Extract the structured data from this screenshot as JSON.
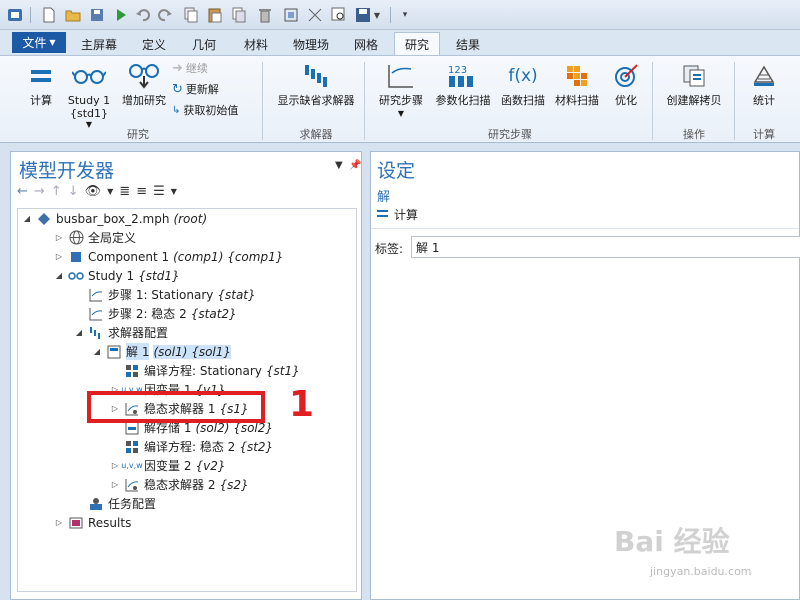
{
  "ribbon": {
    "file_label": "文件",
    "tabs": [
      "主屏幕",
      "定义",
      "几何",
      "材料",
      "物理场",
      "网格",
      "研究",
      "结果"
    ],
    "active_tab": "研究",
    "buttons": {
      "compute": "计算",
      "study1_line1": "Study 1",
      "study1_line2": "{std1}",
      "add_study": "增加研究",
      "continue": "继续",
      "update_solution": "更新解",
      "get_initial": "获取初始值",
      "show_default_solver": "显示缺省求解器",
      "study_steps": "研究步骤",
      "parametric_sweep": "参数化扫描",
      "function_sweep": "函数扫描",
      "material_sweep": "材料扫描",
      "optimization": "优化",
      "create_solution_copy": "创建解拷贝",
      "statistics": "统计"
    },
    "groups": {
      "study": "研究",
      "solver": "求解器",
      "study_steps": "研究步骤",
      "operations": "操作",
      "compute": "计算"
    }
  },
  "model_builder": {
    "title": "模型开发器",
    "tree": [
      {
        "id": "root",
        "label": "busbar_box_2.mph",
        "tag": "(root)"
      },
      {
        "id": "global",
        "label": "全局定义",
        "tag": ""
      },
      {
        "id": "comp1",
        "label": "Component 1",
        "tag": "(comp1) {comp1}"
      },
      {
        "id": "study1",
        "label": "Study 1",
        "tag": "{std1}"
      },
      {
        "id": "step1",
        "label": "步骤 1: Stationary",
        "tag": "{stat}"
      },
      {
        "id": "step2",
        "label": "步骤 2: 稳态 2",
        "tag": "{stat2}"
      },
      {
        "id": "solver_cfg",
        "label": "求解器配置",
        "tag": ""
      },
      {
        "id": "sol1",
        "label": "解 1",
        "tag": "(sol1) {sol1}"
      },
      {
        "id": "compile1",
        "label": "编译方程: Stationary",
        "tag": "{st1}"
      },
      {
        "id": "depvar1",
        "label": "因变量 1",
        "tag": "{v1}"
      },
      {
        "id": "stat_solver1",
        "label": "稳态求解器 1",
        "tag": "{s1}"
      },
      {
        "id": "solstore1",
        "label": "解存储 1",
        "tag": "(sol2) {sol2}"
      },
      {
        "id": "compile2",
        "label": "编译方程: 稳态 2",
        "tag": "{st2}"
      },
      {
        "id": "depvar2",
        "label": "因变量 2",
        "tag": "{v2}"
      },
      {
        "id": "stat_solver2",
        "label": "稳态求解器 2",
        "tag": "{s2}"
      },
      {
        "id": "job_cfg",
        "label": "任务配置",
        "tag": ""
      },
      {
        "id": "results",
        "label": "Results",
        "tag": ""
      }
    ]
  },
  "settings": {
    "title": "设定",
    "subtitle": "解",
    "compute_label": "计算",
    "field_label": "标签:",
    "field_value": "解 1"
  },
  "annotation": {
    "number": "1"
  },
  "watermark": {
    "brand": "Bai 经验",
    "url": "jingyan.baidu.com"
  }
}
